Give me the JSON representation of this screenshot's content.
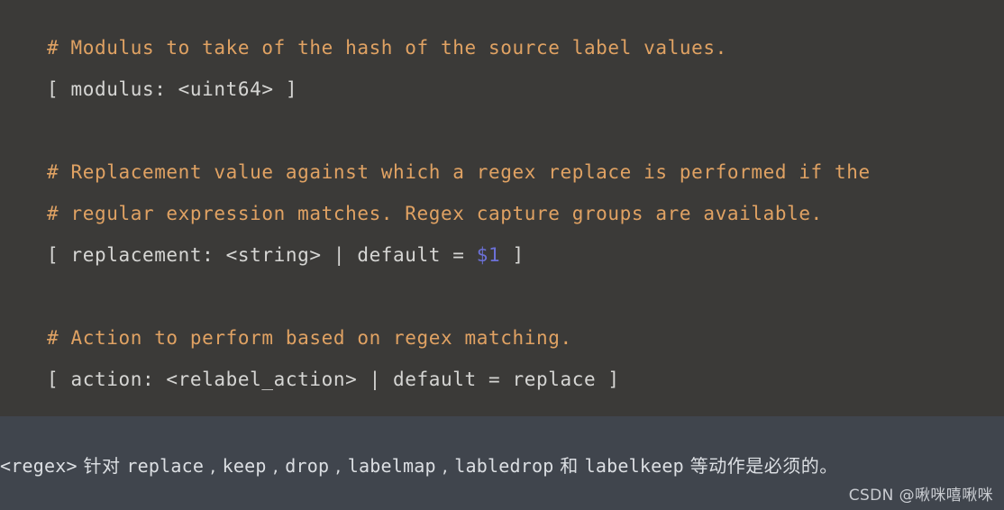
{
  "code_block": {
    "language": "yaml",
    "background_color": "#3b3a38",
    "comment_color": "#e0a263",
    "text_color": "#d6d6d4",
    "variable_color": "#6c71d8",
    "lines": [
      {
        "type": "comment",
        "text": "# Modulus to take of the hash of the source label values."
      },
      {
        "type": "code",
        "text": "[ modulus: <uint64> ]"
      },
      {
        "type": "blank",
        "text": ""
      },
      {
        "type": "comment",
        "text": "# Replacement value against which a regex replace is performed if the"
      },
      {
        "type": "comment",
        "text": "# regular expression matches. Regex capture groups are available."
      },
      {
        "type": "code_var",
        "prefix": "[ replacement: <string> | default = ",
        "variable": "$1",
        "suffix": " ]"
      },
      {
        "type": "blank",
        "text": ""
      },
      {
        "type": "comment",
        "text": "# Action to perform based on regex matching."
      },
      {
        "type": "code",
        "text": "[ action: <relabel_action> | default = replace ]"
      }
    ]
  },
  "caption": {
    "background_color": "#40454d",
    "text_color": "#dcdfe3",
    "segments": [
      {
        "style": "mono",
        "text": "<regex>"
      },
      {
        "style": "cjk",
        "text": " 针对 "
      },
      {
        "style": "mono",
        "text": "replace"
      },
      {
        "style": "cjk",
        "text": " , "
      },
      {
        "style": "mono",
        "text": "keep"
      },
      {
        "style": "cjk",
        "text": " , "
      },
      {
        "style": "mono",
        "text": "drop"
      },
      {
        "style": "cjk",
        "text": " , "
      },
      {
        "style": "mono",
        "text": "labelmap"
      },
      {
        "style": "cjk",
        "text": " , "
      },
      {
        "style": "mono",
        "text": "labledrop"
      },
      {
        "style": "cjk",
        "text": " 和 "
      },
      {
        "style": "mono",
        "text": "labelkeep"
      },
      {
        "style": "cjk",
        "text": " 等动作是必须的。"
      }
    ],
    "full_text": "<regex> 针对 replace , keep , drop , labelmap , labledrop 和 labelkeep 等动作是必须的。"
  },
  "watermark": {
    "text": "CSDN @啾咪嘻啾咪"
  }
}
